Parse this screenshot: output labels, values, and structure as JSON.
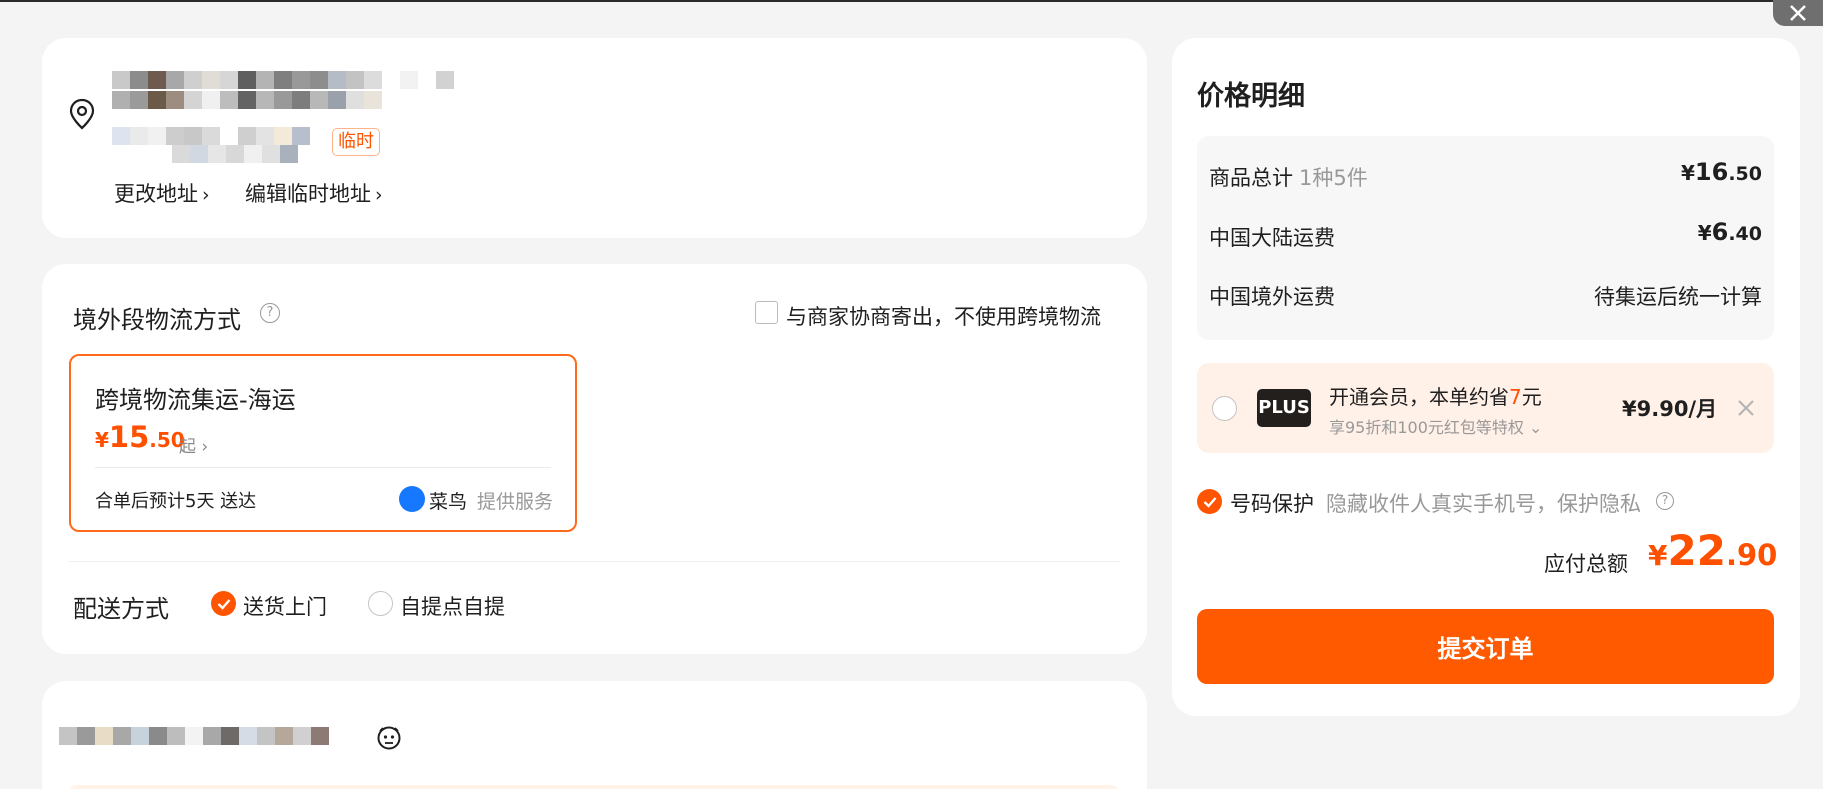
{
  "address": {
    "tag": "临时",
    "change_link": "更改地址",
    "edit_temp_link": "编辑临时地址"
  },
  "logistics": {
    "title": "境外段物流方式",
    "negotiate_option": "与商家协商寄出，不使用跨境物流",
    "negotiate_checked": false,
    "option": {
      "name": "跨境物流集运-海运",
      "currency": "¥",
      "price_int": "15",
      "price_dec": ".50",
      "price_suffix": "起",
      "eta": "合单后预计5天 送达",
      "provider": "菜鸟",
      "provider_suffix": "提供服务"
    }
  },
  "delivery": {
    "title": "配送方式",
    "options": [
      {
        "label": "送货上门",
        "selected": true
      },
      {
        "label": "自提点自提",
        "selected": false
      }
    ]
  },
  "price_detail": {
    "title": "价格明细",
    "rows": [
      {
        "label": "商品总计",
        "sub": "1种5件",
        "currency": "¥",
        "int": "16",
        "dec": ".50"
      },
      {
        "label": "中国大陆运费",
        "currency": "¥",
        "int": "6",
        "dec": ".40"
      },
      {
        "label": "中国境外运费",
        "value_text": "待集运后统一计算"
      }
    ],
    "plus": {
      "badge": "PLUS",
      "title_prefix": "开通会员，本单约省",
      "save_amount": "7",
      "title_suffix": "元",
      "subtitle": "享95折和100元红包等特权",
      "price": "¥9.90/月"
    },
    "privacy": {
      "checked": true,
      "label": "号码保护",
      "desc": "隐藏收件人真实手机号，保护隐私"
    },
    "total": {
      "label": "应付总额",
      "currency": "¥",
      "int": "22",
      "dec": ".90"
    },
    "submit_label": "提交订单"
  },
  "colors": {
    "accent": "#ff5a00",
    "price": "#ff5000",
    "plus_bg": "#fff0e8"
  }
}
